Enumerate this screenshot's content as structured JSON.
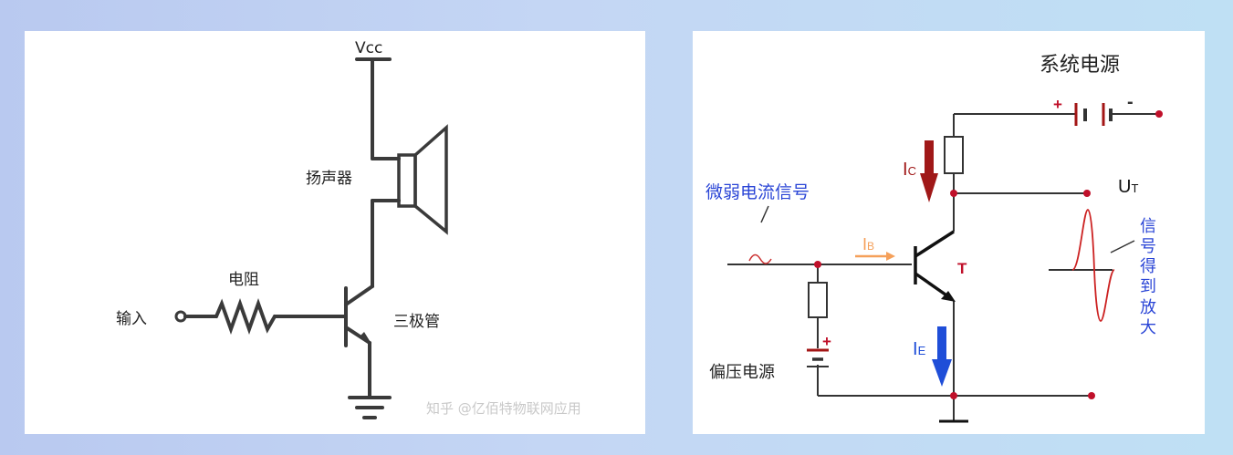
{
  "left": {
    "vcc": "Vcc",
    "speaker": "扬声器",
    "resistor": "电阻",
    "input": "输入",
    "transistor": "三极管",
    "watermark": "知乎 @亿佰特物联网应用"
  },
  "right": {
    "title": "系统电源",
    "plus": "+",
    "minus": "-",
    "ic": "I",
    "ic_sub": "C",
    "ut": "U",
    "ut_sub": "T",
    "weak_signal": "微弱电流信号",
    "ib": "I",
    "ib_sub": "B",
    "t": "T",
    "amplified_chars": [
      "信",
      "号",
      "得",
      "到",
      "放",
      "大"
    ],
    "ie": "I",
    "ie_sub": "E",
    "bias_plus": "+",
    "bias": "偏压电源"
  },
  "colors": {
    "wire": "#333333",
    "dark_red": "#a31515",
    "red_dot": "#c0102a",
    "orange": "#f5a05a",
    "blue": "#1f4ed8",
    "text_blue": "#2a45d6"
  }
}
